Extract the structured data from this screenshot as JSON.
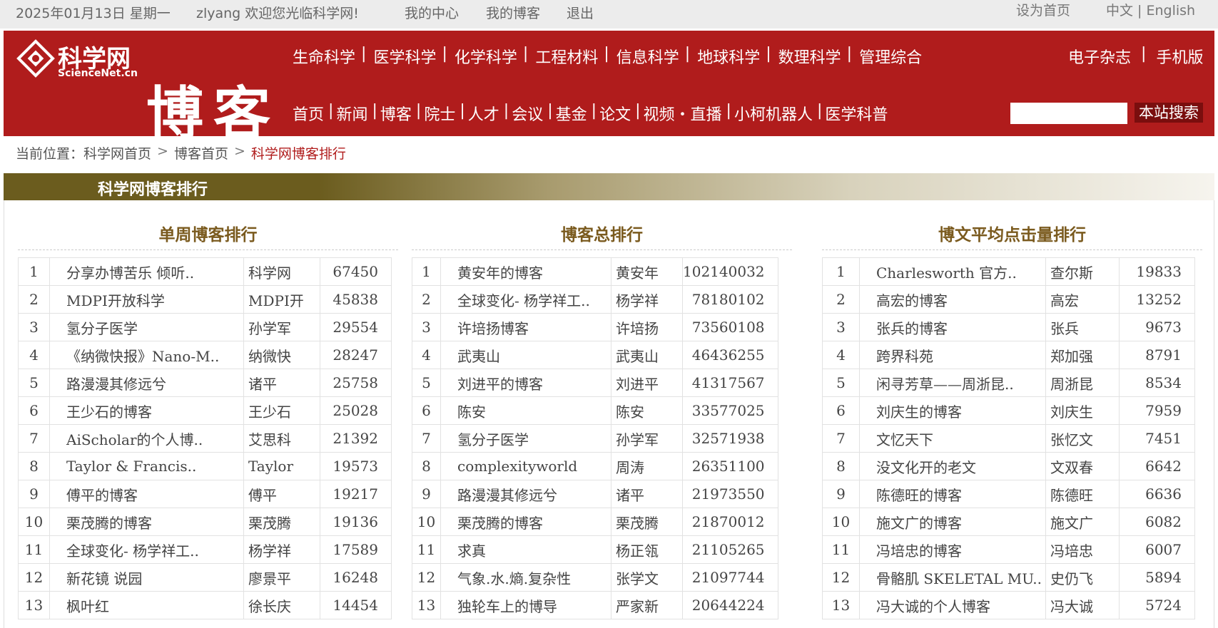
{
  "topbar": {
    "date": "2025年01月13日 星期一",
    "welcome": "zlyang 欢迎您光临科学网!",
    "my_center": "我的中心",
    "my_blog": "我的博客",
    "logout": "退出",
    "set_homepage": "设为首页",
    "lang": "中文 | English"
  },
  "logo": {
    "cn": "科学网",
    "en": "ScienceNet.cn",
    "blog": "博客"
  },
  "nav_primary": [
    "生命科学",
    "医学科学",
    "化学科学",
    "工程材料",
    "信息科学",
    "地球科学",
    "数理科学",
    "管理综合"
  ],
  "nav_right": [
    "电子杂志",
    "手机版"
  ],
  "nav_secondary": [
    "首页",
    "新闻",
    "博客",
    "院士",
    "人才",
    "会议",
    "基金",
    "论文",
    "视频・直播",
    "小柯机器人",
    "医学科普"
  ],
  "search": {
    "button": "本站搜索",
    "value": ""
  },
  "breadcrumb": {
    "prefix": "当前位置：",
    "home": "科学网首页",
    "blog_home": "博客首页",
    "current": "科学网博客排行"
  },
  "section_title": "科学网博客排行",
  "columns": [
    {
      "title": "单周博客排行",
      "rows": [
        [
          "1",
          "分享办博苦乐 倾听..",
          "科学网",
          "67450"
        ],
        [
          "2",
          "MDPI开放科学",
          "MDPI开",
          "45838"
        ],
        [
          "3",
          "氢分子医学",
          "孙学军",
          "29554"
        ],
        [
          "4",
          "《纳微快报》Nano-M..",
          "纳微快",
          "28247"
        ],
        [
          "5",
          "路漫漫其修远兮",
          "诸平",
          "25758"
        ],
        [
          "6",
          "王少石的博客",
          "王少石",
          "25028"
        ],
        [
          "7",
          "AiScholar的个人博..",
          "艾思科",
          "21392"
        ],
        [
          "8",
          "Taylor & Francis..",
          "Taylor",
          "19573"
        ],
        [
          "9",
          "傅平的博客",
          "傅平",
          "19217"
        ],
        [
          "10",
          "栗茂腾的博客",
          "栗茂腾",
          "19136"
        ],
        [
          "11",
          "全球变化- 杨学祥工..",
          "杨学祥",
          "17589"
        ],
        [
          "12",
          "新花镜 说园",
          "廖景平",
          "16248"
        ],
        [
          "13",
          "枫叶红",
          "徐长庆",
          "14454"
        ]
      ]
    },
    {
      "title": "博客总排行",
      "rows": [
        [
          "1",
          "黄安年的博客",
          "黄安年",
          "102140032"
        ],
        [
          "2",
          "全球变化- 杨学祥工..",
          "杨学祥",
          "78180102"
        ],
        [
          "3",
          "许培扬博客",
          "许培扬",
          "73560108"
        ],
        [
          "4",
          "武夷山",
          "武夷山",
          "46436255"
        ],
        [
          "5",
          "刘进平的博客",
          "刘进平",
          "41317567"
        ],
        [
          "6",
          "陈安",
          "陈安",
          "33577025"
        ],
        [
          "7",
          "氢分子医学",
          "孙学军",
          "32571938"
        ],
        [
          "8",
          "complexityworld",
          "周涛",
          "26351100"
        ],
        [
          "9",
          "路漫漫其修远兮",
          "诸平",
          "21973550"
        ],
        [
          "10",
          "栗茂腾的博客",
          "栗茂腾",
          "21870012"
        ],
        [
          "11",
          "求真",
          "杨正瓴",
          "21105265"
        ],
        [
          "12",
          "气象.水.熵.复杂性",
          "张学文",
          "21097744"
        ],
        [
          "13",
          "独轮车上的博导",
          "严家新",
          "20644224"
        ]
      ]
    },
    {
      "title": "博文平均点击量排行",
      "rows": [
        [
          "1",
          "Charlesworth 官方..",
          "查尔斯",
          "19833"
        ],
        [
          "2",
          "高宏的博客",
          "高宏",
          "13252"
        ],
        [
          "3",
          "张兵的博客",
          "张兵",
          "9673"
        ],
        [
          "4",
          "跨界科苑",
          "郑加强",
          "8791"
        ],
        [
          "5",
          "闲寻芳草——周浙昆..",
          "周浙昆",
          "8534"
        ],
        [
          "6",
          "刘庆生的博客",
          "刘庆生",
          "7959"
        ],
        [
          "7",
          "文忆天下",
          "张忆文",
          "7451"
        ],
        [
          "8",
          "没文化开的老文",
          "文双春",
          "6642"
        ],
        [
          "9",
          "陈德旺的博客",
          "陈德旺",
          "6636"
        ],
        [
          "10",
          "施文广的博客",
          "施文广",
          "6082"
        ],
        [
          "11",
          "冯培忠的博客",
          "冯培忠",
          "6007"
        ],
        [
          "12",
          "骨骼肌 SKELETAL MU..",
          "史仍飞",
          "5894"
        ],
        [
          "13",
          "冯大诚的个人博客",
          "冯大诚",
          "5724"
        ]
      ]
    }
  ],
  "colors": {
    "header_red": "#b01c1c",
    "title_brown": "#7a5a1e",
    "breadcrumb_current": "#b01c1c"
  }
}
